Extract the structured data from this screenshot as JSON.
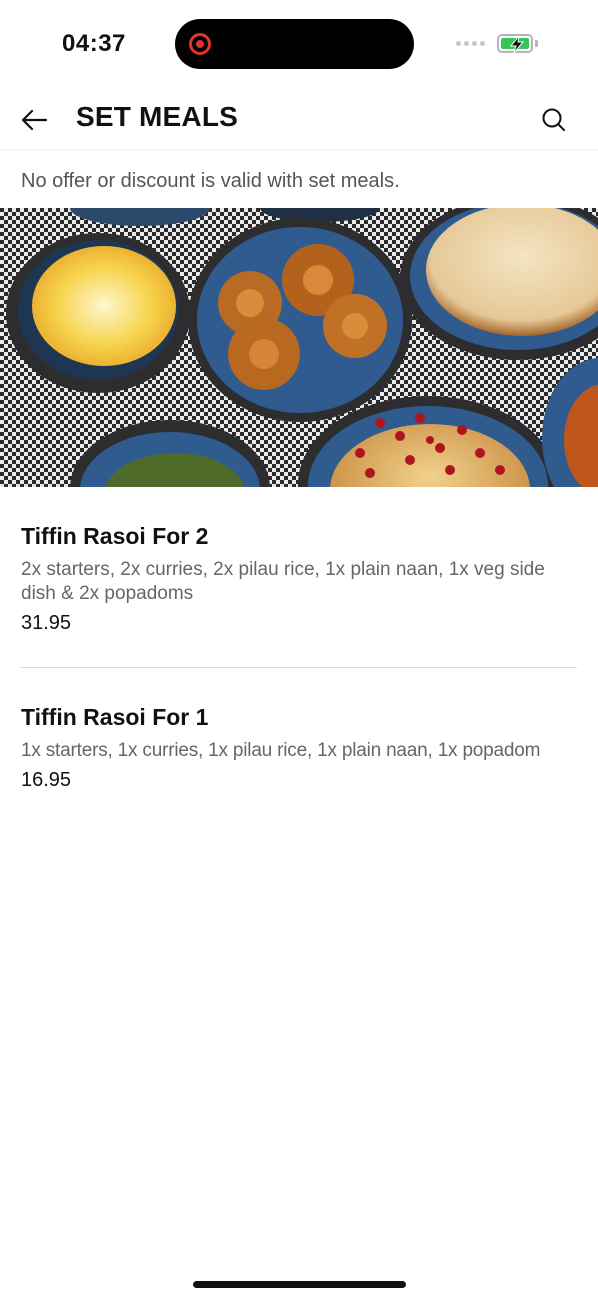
{
  "status_bar": {
    "time": "04:37"
  },
  "header": {
    "title": "SET MEALS"
  },
  "notice": "No offer or discount is valid with set meals.",
  "meals": [
    {
      "name": "Tiffin Rasoi For 2",
      "description": "2x starters, 2x curries, 2x pilau rice, 1x plain naan, 1x veg side dish & 2x popadoms",
      "price": "31.95"
    },
    {
      "name": "Tiffin Rasoi For 1",
      "description": "1x starters, 1x curries, 1x pilau rice, 1x plain naan, 1x popadom",
      "price": "16.95"
    }
  ],
  "icons": {
    "back": "arrow-left-icon",
    "search": "search-icon",
    "recording": "record-icon",
    "battery": "battery-charging-icon"
  },
  "colors": {
    "battery_green": "#33c759",
    "record_red": "#e0332a"
  }
}
